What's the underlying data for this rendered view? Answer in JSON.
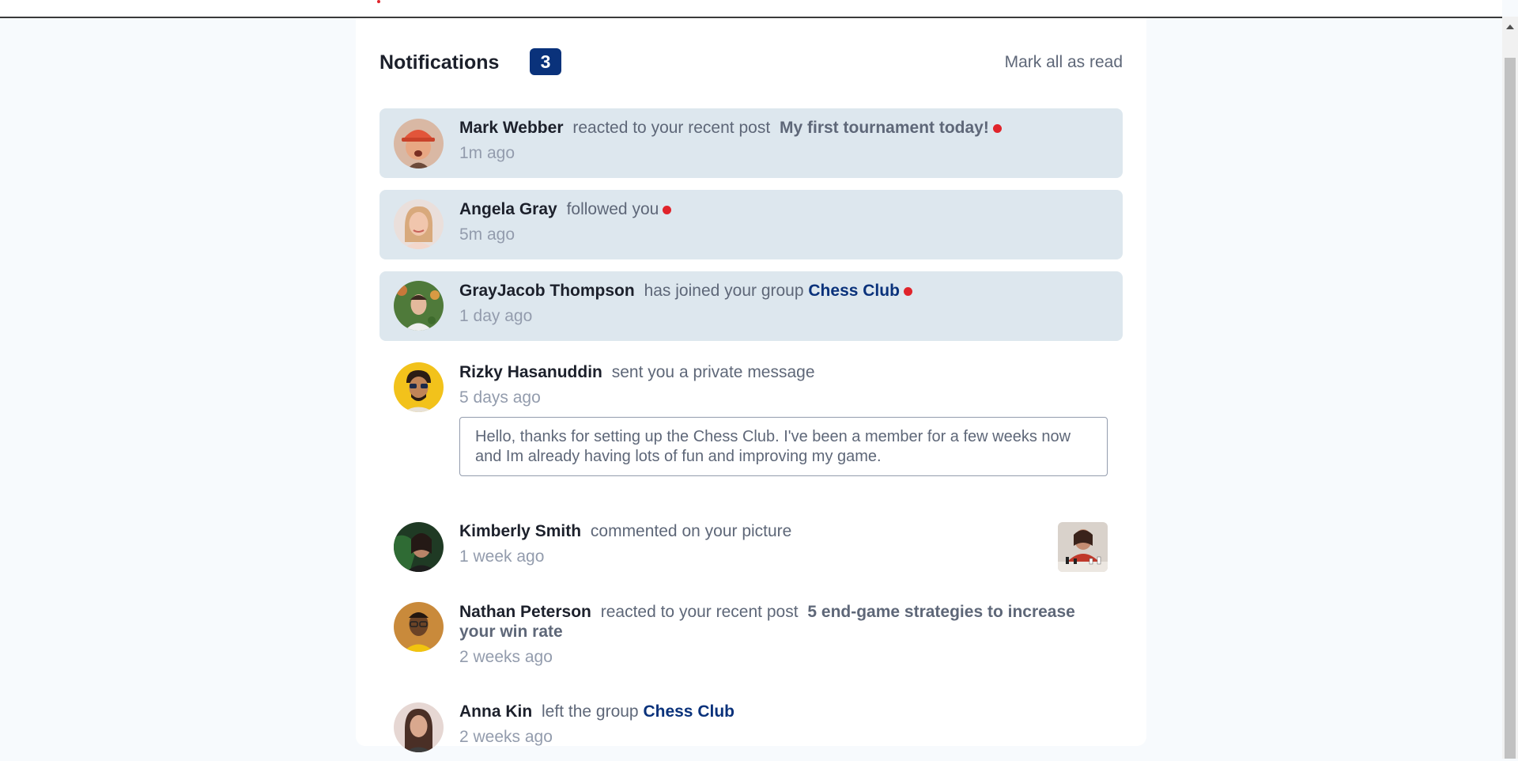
{
  "header": {
    "title": "Notifications",
    "unread_count": "3",
    "mark_all_label": "Mark all as read"
  },
  "notifications": [
    {
      "user": "Mark Webber",
      "action": "reacted to your recent post",
      "post": "My first tournament today!",
      "time": "1m ago",
      "unread": true
    },
    {
      "user": "Angela Gray",
      "action": "followed you",
      "time": "5m ago",
      "unread": true
    },
    {
      "user": "GrayJacob Thompson",
      "action": "has joined your group",
      "group": "Chess Club",
      "time": "1 day ago",
      "unread": true
    },
    {
      "user": "Rizky Hasanuddin",
      "action": "sent you a private message",
      "time": "5 days ago",
      "message": "Hello, thanks for setting up the Chess Club. I've been a member for a few weeks now and Im already having lots of fun and improving my game.",
      "unread": false
    },
    {
      "user": "Kimberly Smith",
      "action": "commented on your picture",
      "time": "1 week ago",
      "unread": false
    },
    {
      "user": "Nathan Peterson",
      "action": "reacted to your recent post",
      "post": "5 end-game strategies to increase your win rate",
      "time": "2 weeks ago",
      "unread": false
    },
    {
      "user": "Anna Kin",
      "action": "left the group",
      "group": "Chess Club",
      "time": "2 weeks ago",
      "unread": false
    }
  ],
  "colors": {
    "accent": "#0a327b",
    "unread_bg": "#dde7ee",
    "red_dot": "#e0242b",
    "page_bg": "#f7fafd"
  }
}
